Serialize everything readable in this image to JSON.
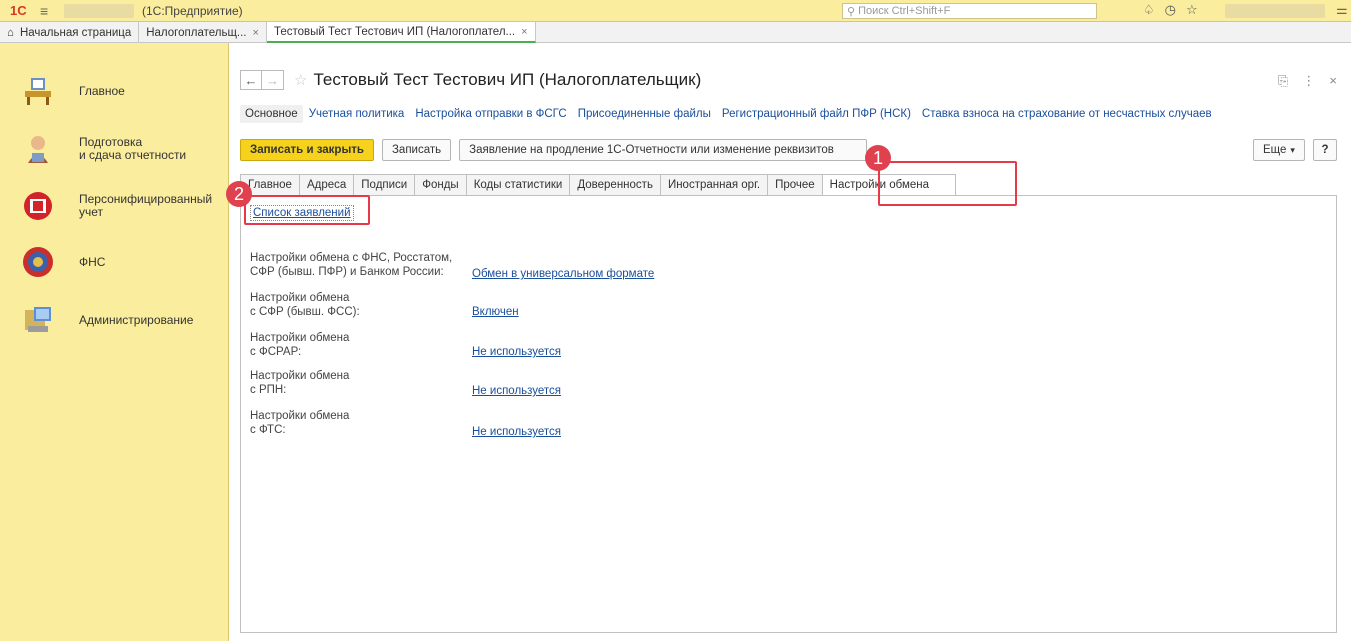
{
  "titlebar": {
    "app_name": "(1С:Предприятие)",
    "search_placeholder": "Поиск Ctrl+Shift+F",
    "logo_text": "1С"
  },
  "window_tabs": [
    {
      "label": "Начальная страница",
      "closable": false
    },
    {
      "label": "Налогоплательщ...",
      "closable": true
    },
    {
      "label": "Тестовый Тест Тестович ИП (Налогоплател...",
      "closable": true
    }
  ],
  "sidebar": {
    "items": [
      {
        "label": "Главное",
        "icon": "desk-icon"
      },
      {
        "label": "Подготовка\nи сдача отчетности",
        "icon": "accountant-icon"
      },
      {
        "label": "Персонифицированный\nучет",
        "icon": "pfr-logo-icon"
      },
      {
        "label": "ФНС",
        "icon": "fns-emblem-icon"
      },
      {
        "label": "Администрирование",
        "icon": "computer-icon"
      }
    ]
  },
  "form": {
    "title": "Тестовый Тест Тестович ИП (Налогоплательщик)",
    "section_links": [
      "Основное",
      "Учетная политика",
      "Настройка отправки в ФСГС",
      "Присоединенные файлы",
      "Регистрационный файл ПФР (НСК)",
      "Ставка взноса на страхование от несчастных случаев"
    ],
    "buttons": {
      "save_close": "Записать и закрыть",
      "save": "Записать",
      "application": "Заявление на продление 1С-Отчетности или изменение реквизитов",
      "more": "Еще",
      "help": "?"
    },
    "tabs": [
      "Главное",
      "Адреса",
      "Подписи",
      "Фонды",
      "Коды статистики",
      "Доверенность",
      "Иностранная орг.",
      "Прочее",
      "Настройки обмена"
    ],
    "applications_link": "Список заявлений",
    "settings": [
      {
        "label": "Настройки обмена с ФНС, Росстатом,\nСФР (бывш. ПФР) и Банком России:",
        "value": "Обмен в универсальном формате"
      },
      {
        "label": "Настройки обмена\nс СФР (бывш. ФСС):",
        "value": "Включен"
      },
      {
        "label": "Настройки обмена\nс ФСРАР:",
        "value": "Не используется"
      },
      {
        "label": "Настройки обмена\nс РПН:",
        "value": "Не используется"
      },
      {
        "label": "Настройки обмена\nс ФТС:",
        "value": "Не используется"
      }
    ]
  },
  "annotations": {
    "badge_1": "1",
    "badge_2": "2",
    "highlight_color": "#e6394a"
  }
}
